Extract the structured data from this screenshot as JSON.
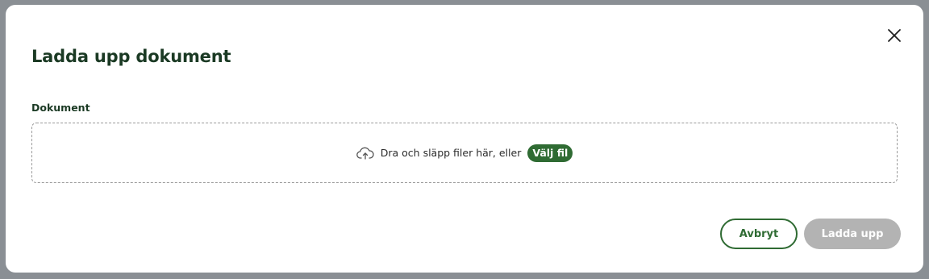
{
  "dialog": {
    "title": "Ladda upp dokument",
    "close_icon": "close-icon"
  },
  "field": {
    "label": "Dokument"
  },
  "dropzone": {
    "icon": "cloud-upload-icon",
    "text": "Dra och släpp filer här, eller",
    "choose_label": "Välj fil"
  },
  "actions": {
    "cancel_label": "Avbryt",
    "upload_label": "Ladda upp",
    "upload_disabled": true
  },
  "colors": {
    "accent": "#2f6b33",
    "title": "#1b3a24",
    "disabled": "#b3b3b3",
    "overlay": "#8a8f94"
  }
}
